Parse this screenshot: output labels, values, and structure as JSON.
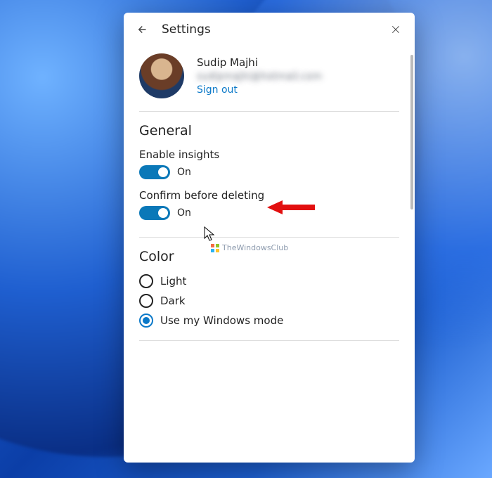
{
  "header": {
    "title": "Settings"
  },
  "profile": {
    "name": "Sudip Majhi",
    "email_masked": "sudipmajhi@hotmail.com",
    "sign_out": "Sign out"
  },
  "sections": {
    "general": {
      "title": "General",
      "enable_insights": {
        "label": "Enable insights",
        "state": "On",
        "on": true
      },
      "confirm_delete": {
        "label": "Confirm before deleting",
        "state": "On",
        "on": true
      }
    },
    "color": {
      "title": "Color",
      "options": {
        "light": "Light",
        "dark": "Dark",
        "windows_mode": "Use my Windows mode"
      },
      "selected": "windows_mode"
    }
  },
  "watermark": "TheWindowsClub",
  "colors": {
    "accent": "#0a78c8",
    "toggle_on": "#0a78b8"
  }
}
